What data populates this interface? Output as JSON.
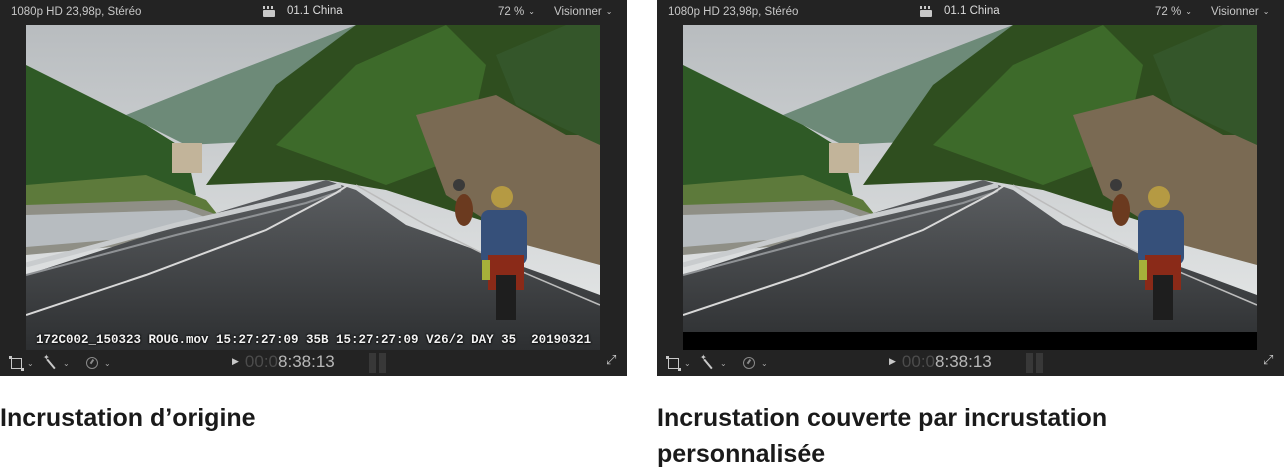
{
  "viewers": [
    {
      "format": "1080p HD 23,98p, Stéréo",
      "clip_name": "01.1 China",
      "zoom": "72 %",
      "view_menu": "Visionner",
      "overlay_text": "172C002_150323 ROUG.mov 15:27:27:09 35B 15:27:27:09 V26/2 DAY 35  20190321",
      "timecode_dim": "00:0",
      "timecode_main": "8:38:13",
      "caption": "Incrustation d’origine"
    },
    {
      "format": "1080p HD 23,98p, Stéréo",
      "clip_name": "01.1 China",
      "zoom": "72 %",
      "view_menu": "Visionner",
      "overlay_text": "",
      "timecode_dim": "00:0",
      "timecode_main": "8:38:13",
      "caption": "Incrustation couverte par incrustation personnalisée"
    }
  ],
  "icons": {
    "clip": "clapper-icon",
    "transform": "transform-icon",
    "enhance": "magic-wand-icon",
    "speed": "speed-gauge-icon",
    "play": "play-icon",
    "fullscreen": "fullscreen-icon"
  },
  "colors": {
    "viewer_background": "#232323",
    "custom_overlay_bar": "#000000"
  }
}
